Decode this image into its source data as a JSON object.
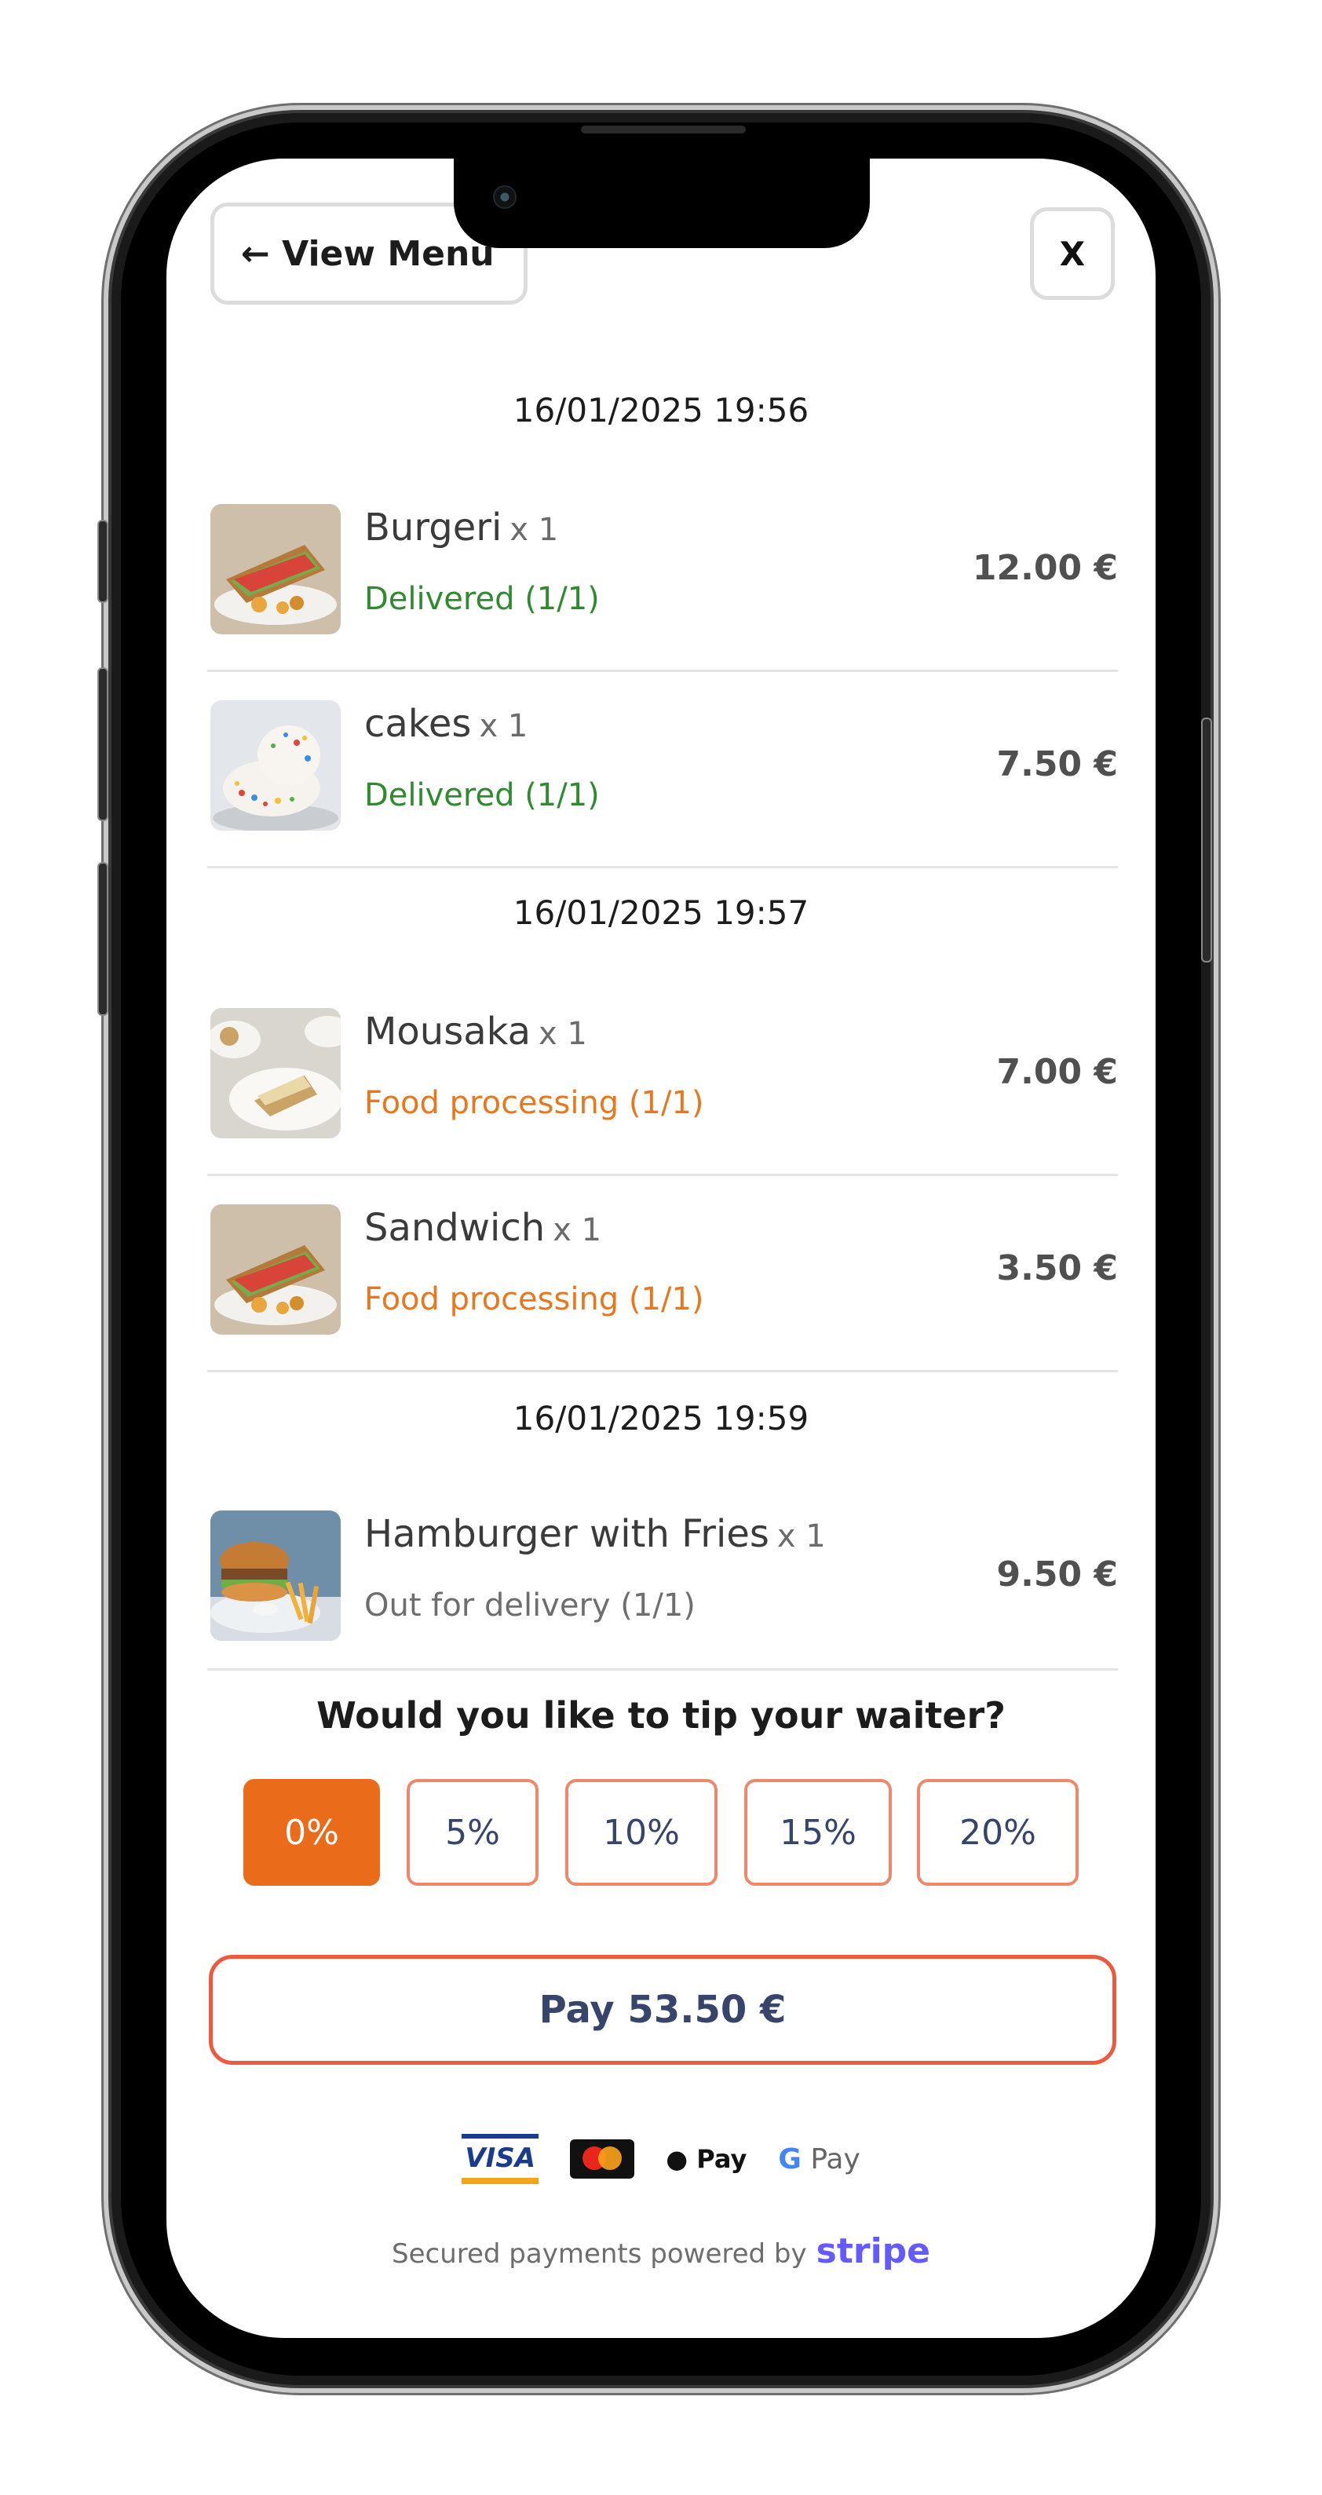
{
  "header": {
    "back_label": "← View Menu",
    "close_label": "X"
  },
  "order_groups": [
    {
      "timestamp": "16/01/2025 19:56",
      "items": [
        {
          "name": "Burgeri",
          "qty": "x 1",
          "status": "Delivered (1/1)",
          "status_type": "green",
          "price": "12.00 €",
          "thumb_icon": "burger-photo"
        },
        {
          "name": "cakes",
          "qty": "x 1",
          "status": "Delivered (1/1)",
          "status_type": "green",
          "price": "7.50 €",
          "thumb_icon": "cake-photo"
        }
      ]
    },
    {
      "timestamp": "16/01/2025 19:57",
      "items": [
        {
          "name": "Mousaka",
          "qty": "x 1",
          "status": "Food processing (1/1)",
          "status_type": "orange",
          "price": "7.00 €",
          "thumb_icon": "mousaka-photo"
        },
        {
          "name": "Sandwich",
          "qty": "x 1",
          "status": "Food processing (1/1)",
          "status_type": "orange",
          "price": "3.50 €",
          "thumb_icon": "sandwich-photo"
        }
      ]
    },
    {
      "timestamp": "16/01/2025 19:59",
      "items": [
        {
          "name": "Hamburger with Fries",
          "qty": "x 1",
          "status": "Out for delivery (1/1)",
          "status_type": "gray",
          "price": "9.50 €",
          "thumb_icon": "hamburger-photo"
        }
      ]
    }
  ],
  "tip": {
    "question": "Would you like to tip your waiter?",
    "options": [
      "0%",
      "5%",
      "10%",
      "15%",
      "20%"
    ],
    "selected": "0%"
  },
  "pay_button_label": "Pay 53.50 €",
  "payment_logos": {
    "visa": "VISA",
    "apple_pay": " Pay",
    "google_pay_g": "G",
    "google_pay_text": " Pay"
  },
  "footer": {
    "secured_text": "Secured payments powered by",
    "stripe_text": "stripe"
  },
  "colors": {
    "accent_orange": "#ea6b1a",
    "status_green": "#2e8b2e",
    "status_orange": "#e8781e",
    "pay_border": "#ee5a3e",
    "stripe_purple": "#635bff"
  }
}
